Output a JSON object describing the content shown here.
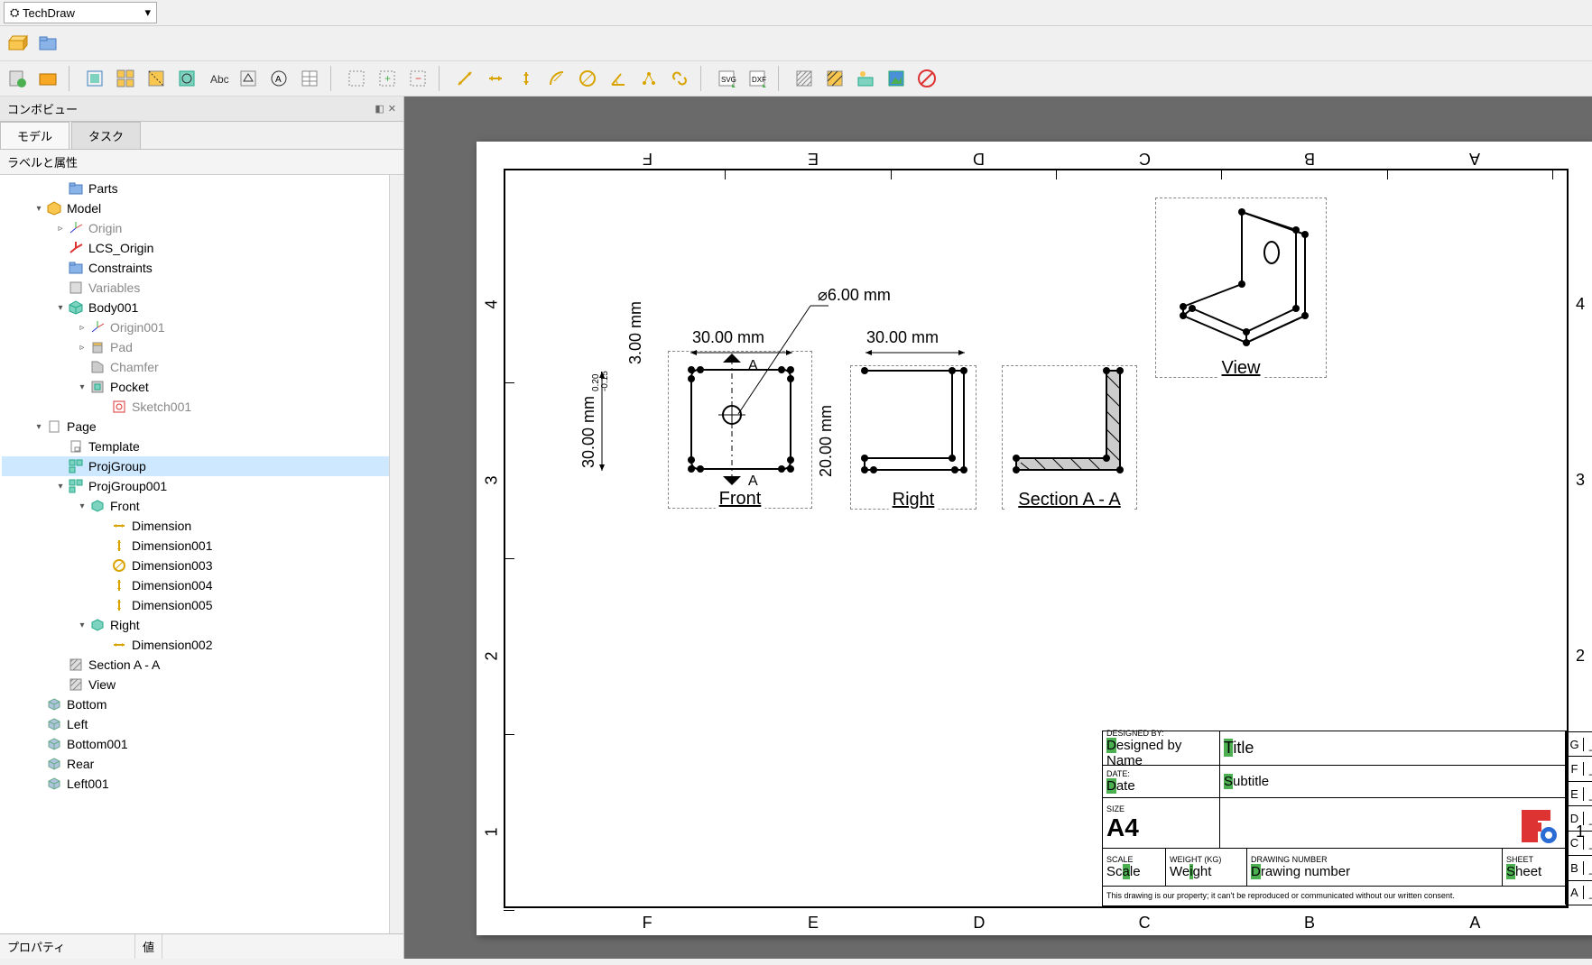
{
  "workbench": {
    "name": "TechDraw",
    "arrow": "▾"
  },
  "panel": {
    "title": "コンボビュー",
    "tabs": {
      "model": "モデル",
      "task": "タスク"
    },
    "tree_header": "ラベルと属性",
    "prop_label": "プロパティ",
    "prop_value": "値"
  },
  "tree": [
    {
      "d": 1,
      "exp": "",
      "icon": "folder",
      "label": "Parts",
      "grey": false
    },
    {
      "d": 0,
      "exp": "▾",
      "icon": "model",
      "label": "Model",
      "grey": false
    },
    {
      "d": 1,
      "exp": "▹",
      "icon": "axis",
      "label": "Origin",
      "grey": true
    },
    {
      "d": 1,
      "exp": "",
      "icon": "axis-red",
      "label": "LCS_Origin",
      "grey": false
    },
    {
      "d": 1,
      "exp": "",
      "icon": "folder",
      "label": "Constraints",
      "grey": false
    },
    {
      "d": 1,
      "exp": "",
      "icon": "var",
      "label": "Variables",
      "grey": true
    },
    {
      "d": 1,
      "exp": "▾",
      "icon": "body",
      "label": "Body001",
      "grey": false
    },
    {
      "d": 2,
      "exp": "▹",
      "icon": "axis",
      "label": "Origin001",
      "grey": true
    },
    {
      "d": 2,
      "exp": "▹",
      "icon": "pad",
      "label": "Pad",
      "grey": true
    },
    {
      "d": 2,
      "exp": "",
      "icon": "chamfer",
      "label": "Chamfer",
      "grey": true
    },
    {
      "d": 2,
      "exp": "▾",
      "icon": "pocket",
      "label": "Pocket",
      "grey": false
    },
    {
      "d": 3,
      "exp": "",
      "icon": "sketch",
      "label": "Sketch001",
      "grey": true
    },
    {
      "d": 0,
      "exp": "▾",
      "icon": "page",
      "label": "Page",
      "grey": false
    },
    {
      "d": 1,
      "exp": "",
      "icon": "template",
      "label": "Template",
      "grey": false
    },
    {
      "d": 1,
      "exp": "",
      "icon": "projgroup",
      "label": "ProjGroup",
      "grey": false,
      "selected": true
    },
    {
      "d": 1,
      "exp": "▾",
      "icon": "projgroup",
      "label": "ProjGroup001",
      "grey": false
    },
    {
      "d": 2,
      "exp": "▾",
      "icon": "view3d",
      "label": "Front",
      "grey": false
    },
    {
      "d": 3,
      "exp": "",
      "icon": "dim-h",
      "label": "Dimension",
      "grey": false
    },
    {
      "d": 3,
      "exp": "",
      "icon": "dim-v",
      "label": "Dimension001",
      "grey": false
    },
    {
      "d": 3,
      "exp": "",
      "icon": "dim-d",
      "label": "Dimension003",
      "grey": false
    },
    {
      "d": 3,
      "exp": "",
      "icon": "dim-v",
      "label": "Dimension004",
      "grey": false
    },
    {
      "d": 3,
      "exp": "",
      "icon": "dim-v",
      "label": "Dimension005",
      "grey": false
    },
    {
      "d": 2,
      "exp": "▾",
      "icon": "view3d",
      "label": "Right",
      "grey": false
    },
    {
      "d": 3,
      "exp": "",
      "icon": "dim-h",
      "label": "Dimension002",
      "grey": false
    },
    {
      "d": 1,
      "exp": "",
      "icon": "section",
      "label": "Section A - A",
      "grey": false
    },
    {
      "d": 1,
      "exp": "",
      "icon": "section",
      "label": "View",
      "grey": false
    },
    {
      "d": 0,
      "exp": "",
      "icon": "box",
      "label": "Bottom",
      "grey": false
    },
    {
      "d": 0,
      "exp": "",
      "icon": "box",
      "label": "Left",
      "grey": false
    },
    {
      "d": 0,
      "exp": "",
      "icon": "box",
      "label": "Bottom001",
      "grey": false
    },
    {
      "d": 0,
      "exp": "",
      "icon": "box",
      "label": "Rear",
      "grey": false
    },
    {
      "d": 0,
      "exp": "",
      "icon": "box",
      "label": "Left001",
      "grey": false
    }
  ],
  "drawing": {
    "zones_top": [
      "F",
      "E",
      "D",
      "C",
      "B",
      "A"
    ],
    "zones_left": [
      "4",
      "3",
      "2",
      "1"
    ],
    "views": {
      "front": {
        "label": "Front",
        "dims": {
          "w": "30.00 mm",
          "h": "30.00 mm",
          "t": "3.00 mm",
          "hole": "⌀6.00 mm",
          "small_h": "20.00 mm",
          "tol_top": "0.20",
          "tol_bot": "-0.15"
        }
      },
      "right": {
        "label": "Right",
        "dims": {
          "w": "30.00 mm"
        }
      },
      "section": {
        "label": "Section A - A"
      },
      "iso": {
        "label": "View"
      }
    },
    "section_marks": {
      "letter": "A"
    },
    "titleblock": {
      "designed_by_label": "DESIGNED BY:",
      "designed_by": "Designed by Name",
      "date_label": "DATE:",
      "date": "Date",
      "size_label": "SIZE",
      "size": "A4",
      "title_label": "",
      "title": "Title",
      "subtitle": "Subtitle",
      "scale_label": "SCALE",
      "scale": "Scale",
      "weight_label": "WEIGHT (kg)",
      "weight": "Weight",
      "dn_label": "DRAWING NUMBER",
      "dn": "Drawing number",
      "sheet_label": "SHEET",
      "sheet": "Sheet",
      "footer": "This drawing is our property; it can't be reproduced or communicated without our written consent.",
      "revs": [
        "G",
        "F",
        "E",
        "D",
        "C",
        "B",
        "A"
      ],
      "rev_dash": "_"
    }
  }
}
